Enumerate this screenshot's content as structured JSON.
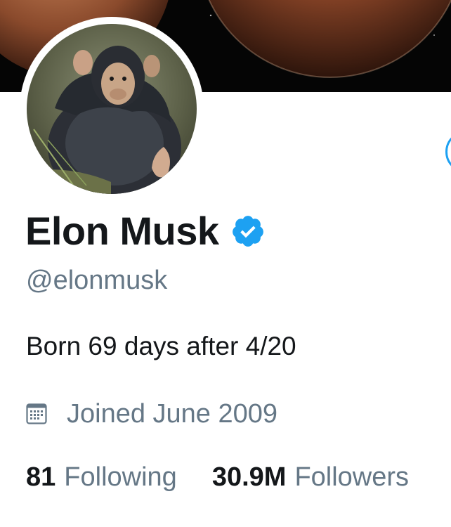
{
  "profile": {
    "display_name": "Elon Musk",
    "handle": "@elonmusk",
    "bio": "Born 69 days after 4/20",
    "joined": "Joined June 2009",
    "following_count": "81",
    "following_label": "Following",
    "followers_count": "30.9M",
    "followers_label": "Followers"
  },
  "icons": {
    "verified": "verified-badge-icon",
    "calendar": "calendar-icon"
  },
  "colors": {
    "accent": "#1DA1F2",
    "text_primary": "#14171A",
    "text_secondary": "#657786"
  }
}
